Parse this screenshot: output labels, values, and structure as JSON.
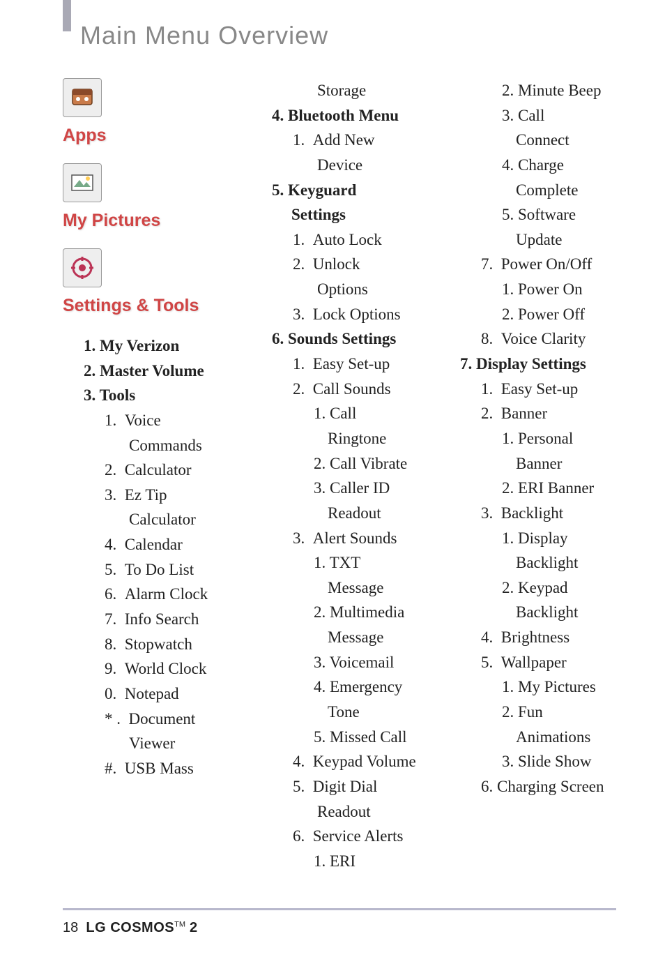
{
  "header": {
    "title": "Main Menu Overview"
  },
  "sections": {
    "apps": "Apps",
    "my_pictures": "My Pictures",
    "settings_tools": "Settings & Tools"
  },
  "col1": {
    "l1": {
      "n": "1.",
      "t": "My Verizon"
    },
    "l2": {
      "n": "2.",
      "t": "Master Volume"
    },
    "l3": {
      "n": "3.",
      "t": "Tools"
    },
    "l4": {
      "n": "1.",
      "t": "Voice"
    },
    "l4b": "Commands",
    "l5": {
      "n": "2.",
      "t": "Calculator"
    },
    "l6": {
      "n": "3.",
      "t": "Ez Tip"
    },
    "l6b": "Calculator",
    "l7": {
      "n": "4.",
      "t": "Calendar"
    },
    "l8": {
      "n": "5.",
      "t": "To Do List"
    },
    "l9": {
      "n": "6.",
      "t": "Alarm Clock"
    },
    "l10": {
      "n": "7.",
      "t": "Info Search"
    },
    "l11": {
      "n": "8.",
      "t": "Stopwatch"
    },
    "l12": {
      "n": "9.",
      "t": "World Clock"
    },
    "l13": {
      "n": "0.",
      "t": "Notepad"
    },
    "l14": {
      "n": "* .",
      "t": "Document"
    },
    "l14b": "Viewer",
    "l15": {
      "n": "#.",
      "t": "USB Mass"
    }
  },
  "col2": {
    "l0": "Storage",
    "l1": {
      "n": "4.",
      "t": "Bluetooth Menu"
    },
    "l2": {
      "n": "1.",
      "t": "Add New"
    },
    "l2b": "Device",
    "l3": {
      "n": "5.",
      "t": "Keyguard"
    },
    "l3b": "Settings",
    "l4": {
      "n": "1.",
      "t": "Auto Lock"
    },
    "l5": {
      "n": "2.",
      "t": "Unlock"
    },
    "l5b": "Options",
    "l6": {
      "n": "3.",
      "t": "Lock Options"
    },
    "l7": {
      "n": "6.",
      "t": "Sounds Settings"
    },
    "l8": {
      "n": "1.",
      "t": "Easy Set-up"
    },
    "l9": {
      "n": "2.",
      "t": "Call Sounds"
    },
    "l10": {
      "n": "1.",
      "t": "Call"
    },
    "l10b": "Ringtone",
    "l11": {
      "n": "2.",
      "t": "Call Vibrate"
    },
    "l12": {
      "n": "3.",
      "t": "Caller ID"
    },
    "l12b": "Readout",
    "l13": {
      "n": "3.",
      "t": "Alert Sounds"
    },
    "l14": {
      "n": "1.",
      "t": "TXT"
    },
    "l14b": "Message",
    "l15": {
      "n": "2.",
      "t": "Multimedia"
    },
    "l15b": "Message",
    "l16": {
      "n": "3.",
      "t": "Voicemail"
    },
    "l17": {
      "n": "4.",
      "t": "Emergency"
    },
    "l17b": "Tone",
    "l18": {
      "n": "5.",
      "t": "Missed Call"
    },
    "l19": {
      "n": "4.",
      "t": "Keypad Volume"
    },
    "l20": {
      "n": "5.",
      "t": "Digit Dial"
    },
    "l20b": "Readout",
    "l21": {
      "n": "6.",
      "t": "Service Alerts"
    },
    "l22": {
      "n": "1.",
      "t": "ERI"
    }
  },
  "col3": {
    "l1": {
      "n": "2.",
      "t": "Minute Beep"
    },
    "l2": {
      "n": "3.",
      "t": "Call"
    },
    "l2b": "Connect",
    "l3": {
      "n": "4.",
      "t": "Charge"
    },
    "l3b": "Complete",
    "l4": {
      "n": "5.",
      "t": "Software"
    },
    "l4b": "Update",
    "l5": {
      "n": "7.",
      "t": "Power On/Off"
    },
    "l6": {
      "n": "1.",
      "t": "Power On"
    },
    "l7": {
      "n": "2.",
      "t": "Power Off"
    },
    "l8": {
      "n": "8.",
      "t": "Voice Clarity"
    },
    "l9": {
      "n": "7.",
      "t": "Display Settings"
    },
    "l10": {
      "n": "1.",
      "t": "Easy Set-up"
    },
    "l11": {
      "n": "2.",
      "t": "Banner"
    },
    "l12": {
      "n": "1.",
      "t": "Personal"
    },
    "l12b": "Banner",
    "l13": {
      "n": "2.",
      "t": "ERI Banner"
    },
    "l14": {
      "n": "3.",
      "t": "Backlight"
    },
    "l15": {
      "n": "1.",
      "t": "Display"
    },
    "l15b": "Backlight",
    "l16": {
      "n": "2.",
      "t": "Keypad"
    },
    "l16b": "Backlight",
    "l17": {
      "n": "4.",
      "t": "Brightness"
    },
    "l18": {
      "n": "5.",
      "t": "Wallpaper"
    },
    "l19": {
      "n": "1.",
      "t": "My Pictures"
    },
    "l20": {
      "n": "2.",
      "t": "Fun"
    },
    "l20b": "Animations",
    "l21": {
      "n": "3.",
      "t": "Slide Show"
    },
    "l22": {
      "n": "6.",
      "t": "Charging Screen"
    }
  },
  "footer": {
    "page": "18",
    "brand": "LG COSMOS",
    "tm": "TM",
    "model": " 2"
  }
}
